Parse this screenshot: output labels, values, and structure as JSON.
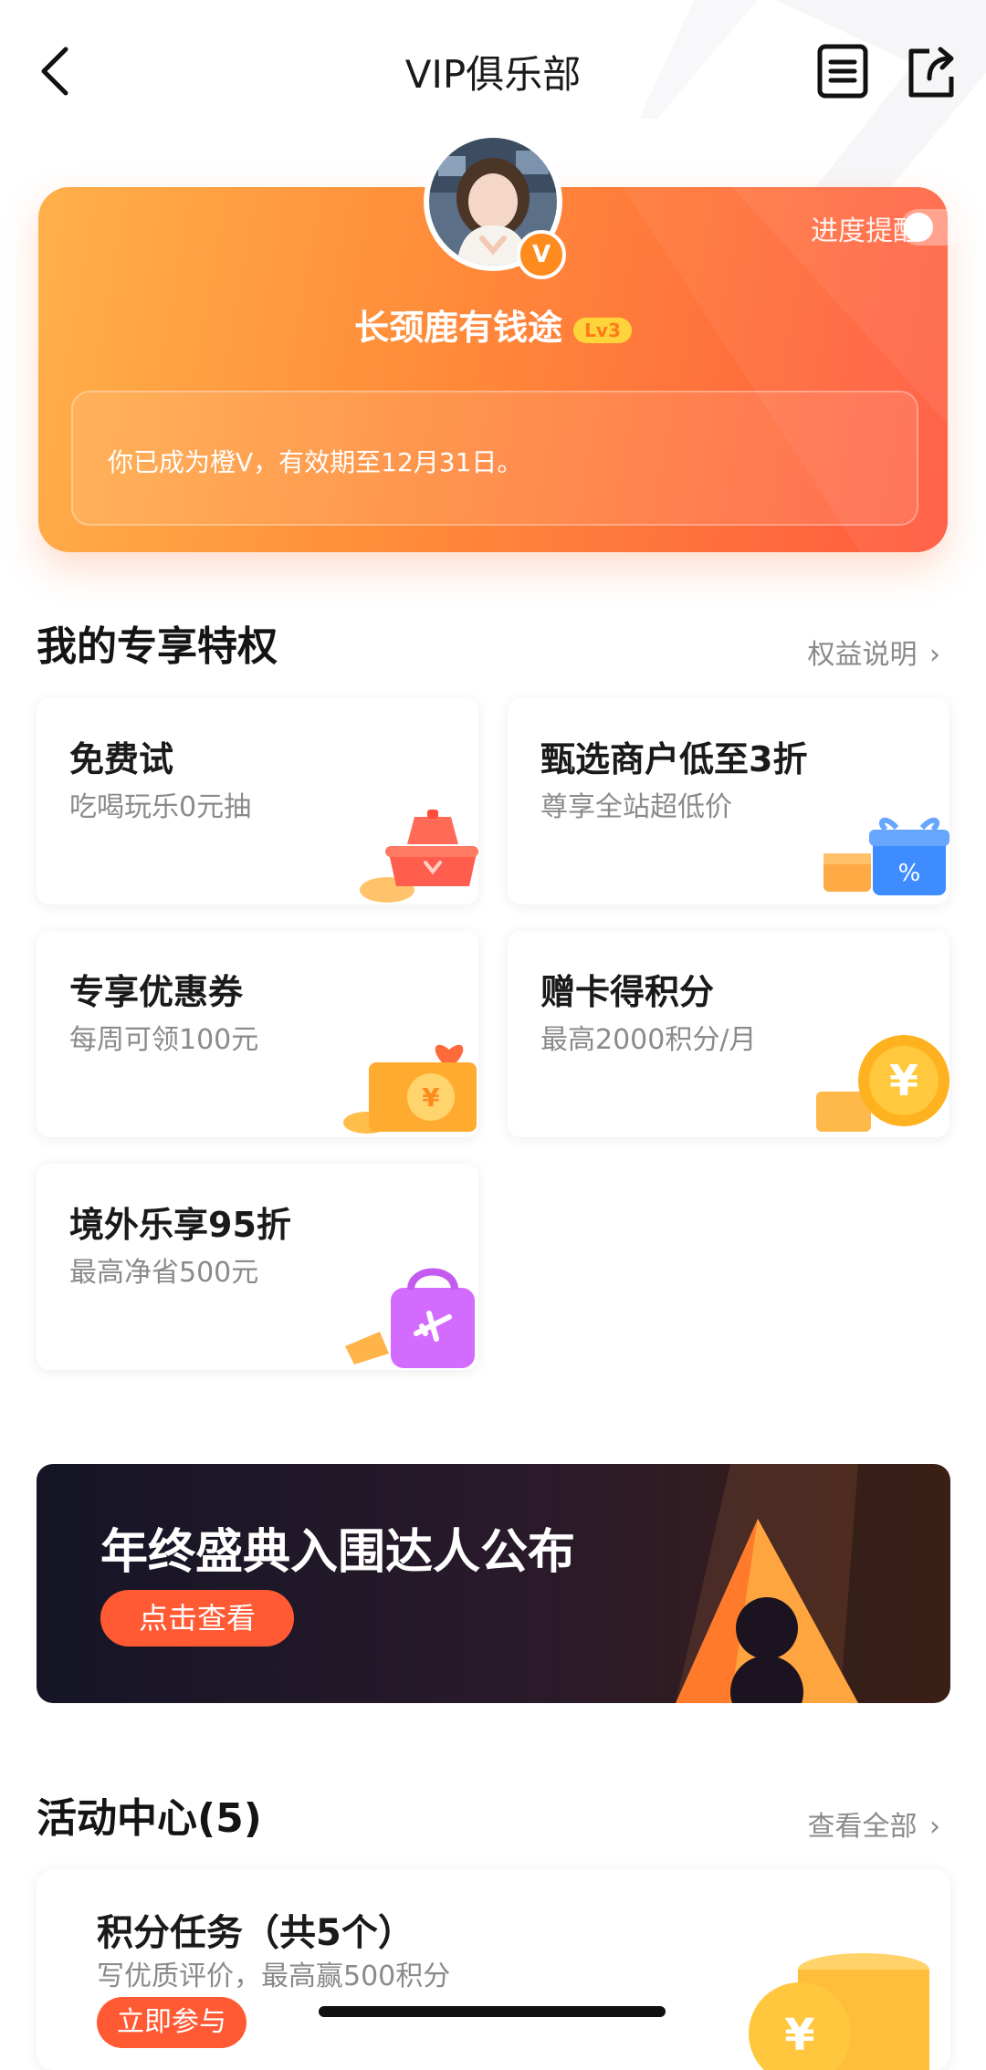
{
  "nav": {
    "title": "VIP俱乐部"
  },
  "vip": {
    "remind_label": "进度提醒",
    "remind_on": false,
    "username": "长颈鹿有钱途",
    "level": "Lv3",
    "badge": "V",
    "status": "你已成为橙V，有效期至12月31日。"
  },
  "perks": {
    "title": "我的专享特权",
    "link": "权益说明",
    "items": [
      {
        "title": "免费试",
        "sub": "吃喝玩乐0元抽",
        "icon": "food-pot-icon"
      },
      {
        "title": "甄选商户低至3折",
        "sub": "尊享全站超低价",
        "icon": "gift-box-percent-icon"
      },
      {
        "title": "专享优惠券",
        "sub": "每周可领100元",
        "icon": "coupon-yen-icon"
      },
      {
        "title": "赠卡得积分",
        "sub": "最高2000积分/月",
        "icon": "yen-coin-icon"
      },
      {
        "title": "境外乐享95折",
        "sub": "最高净省500元",
        "icon": "travel-bag-icon"
      }
    ]
  },
  "banner": {
    "title": "年终盛典入围达人公布",
    "button": "点击查看"
  },
  "activities": {
    "title": "活动中心(5)",
    "link": "查看全部",
    "card": {
      "title": "积分任务（共5个）",
      "sub": "写优质评价，最高赢500积分",
      "button": "立即参与"
    }
  },
  "colors": {
    "accent": "#ff5a34",
    "vip_gradient_start": "#ffb04a",
    "vip_gradient_end": "#ff5a40"
  }
}
